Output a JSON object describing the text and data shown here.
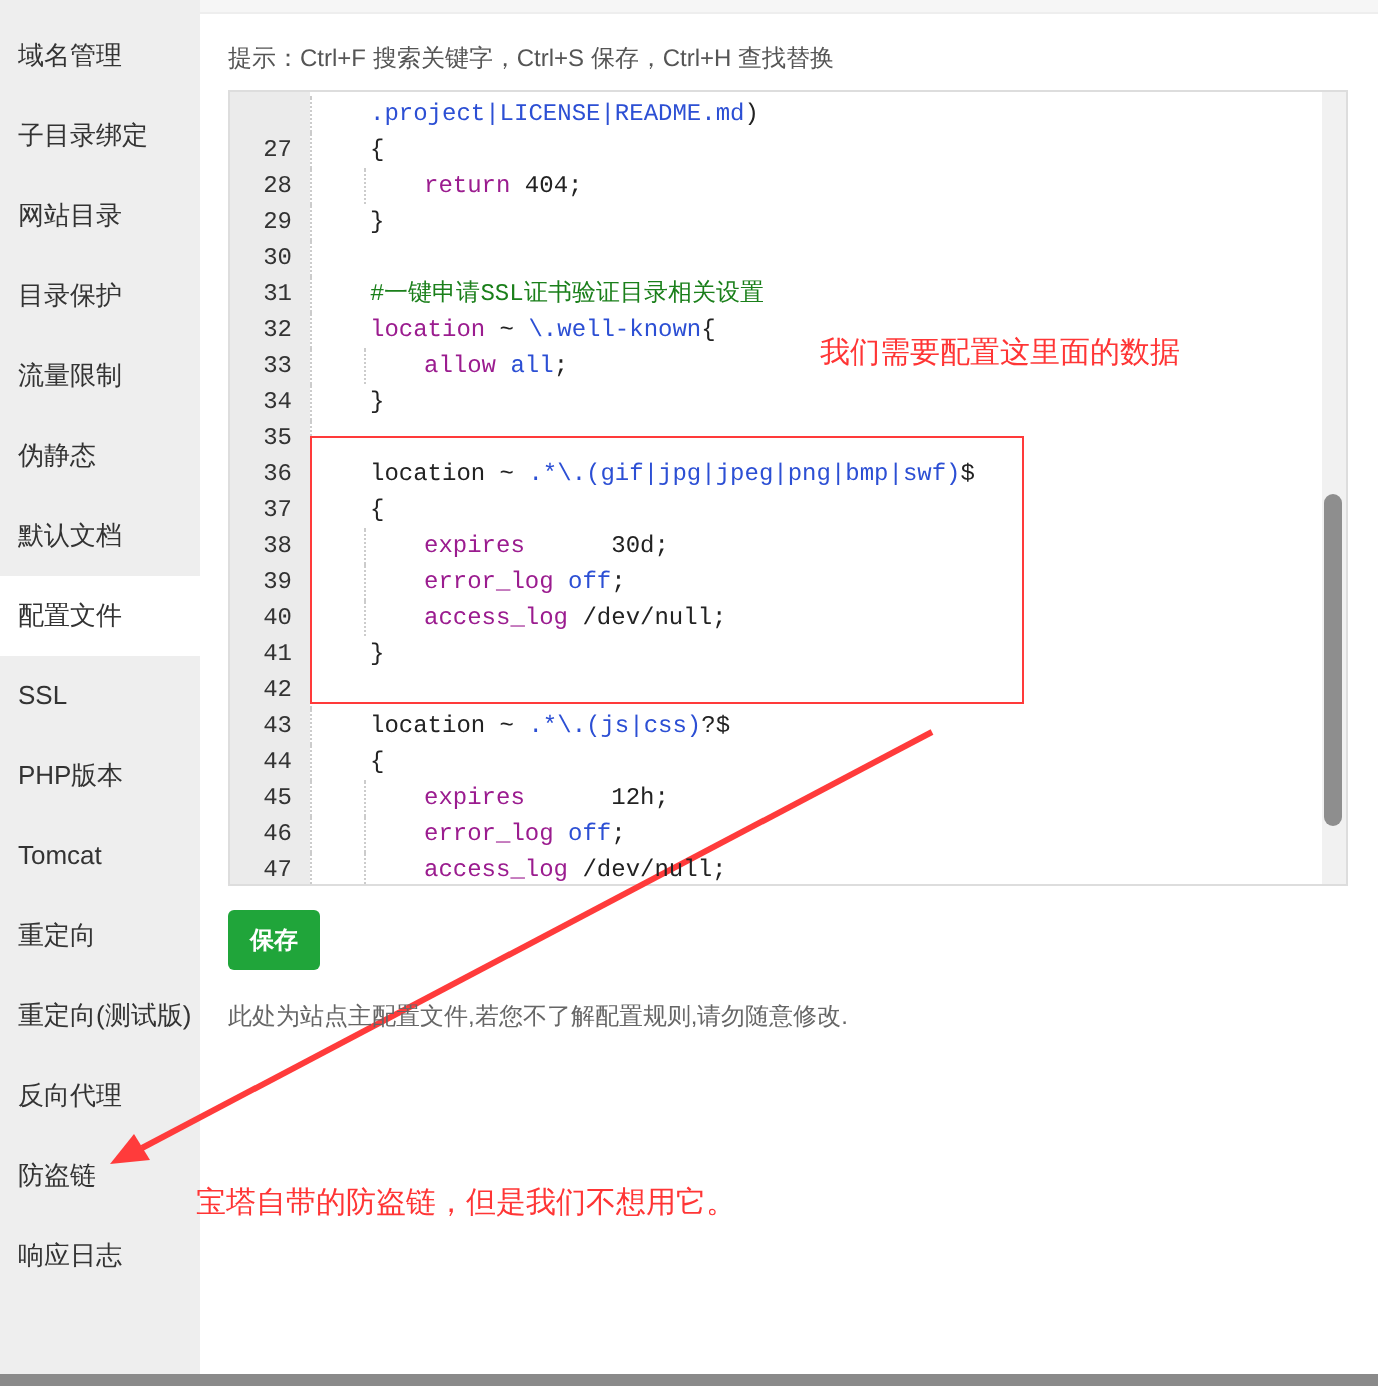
{
  "sidebar": {
    "items": [
      {
        "label": "域名管理",
        "selected": false
      },
      {
        "label": "子目录绑定",
        "selected": false
      },
      {
        "label": "网站目录",
        "selected": false
      },
      {
        "label": "目录保护",
        "selected": false
      },
      {
        "label": "流量限制",
        "selected": false
      },
      {
        "label": "伪静态",
        "selected": false
      },
      {
        "label": "默认文档",
        "selected": false
      },
      {
        "label": "配置文件",
        "selected": true
      },
      {
        "label": "SSL",
        "selected": false
      },
      {
        "label": "PHP版本",
        "selected": false
      },
      {
        "label": "Tomcat",
        "selected": false
      },
      {
        "label": "重定向",
        "selected": false
      },
      {
        "label": "重定向(测试版)",
        "selected": false
      },
      {
        "label": "反向代理",
        "selected": false
      },
      {
        "label": "防盗链",
        "selected": false
      },
      {
        "label": "响应日志",
        "selected": false
      }
    ]
  },
  "hint": "提示：Ctrl+F 搜索关键字，Ctrl+S 保存，Ctrl+H 查找替换",
  "editor": {
    "lines": [
      {
        "tokens": [
          {
            "text": ".project|LICENSE|README.md",
            "kind": "value"
          },
          {
            "text": ")",
            "kind": "plain"
          }
        ]
      },
      {
        "number": "27",
        "tokens": [
          {
            "text": "{",
            "kind": "plain"
          }
        ],
        "children": [
          {
            "number": "28",
            "tokens": [
              {
                "text": "return",
                "kind": "keyword"
              },
              {
                "text": " 404;",
                "kind": "plain"
              }
            ]
          }
        ]
      },
      {
        "number": "29",
        "tokens": [
          {
            "text": "}",
            "kind": "plain"
          }
        ]
      },
      {
        "number": "30"
      },
      {
        "number": "31",
        "tokens": [
          {
            "text": "#一键申请SSL证书验证目录相关设置",
            "kind": "comment"
          }
        ]
      },
      {
        "number": "32",
        "tokens": [
          {
            "text": "location",
            "kind": "keyword"
          },
          {
            "text": " ~ ",
            "kind": "plain"
          },
          {
            "text": "\\.well-known",
            "kind": "value"
          },
          {
            "text": "{",
            "kind": "plain"
          }
        ],
        "children": [
          {
            "number": "33",
            "tokens": [
              {
                "text": "allow ",
                "kind": "keyword"
              },
              {
                "text": "all",
                "kind": "value"
              },
              {
                "text": ";",
                "kind": "plain"
              }
            ]
          }
        ]
      },
      {
        "number": "34",
        "tokens": [
          {
            "text": "}",
            "kind": "plain"
          }
        ]
      },
      {
        "number": "35"
      },
      {
        "number": "36",
        "tokens": [
          {
            "text": "location ~ ",
            "kind": "plain"
          },
          {
            "text": ".*\\.(gif|jpg|jpeg|png|bmp|swf)",
            "kind": "value"
          },
          {
            "text": "$",
            "kind": "plain"
          }
        ]
      },
      {
        "number": "37",
        "tokens": [
          {
            "text": "{",
            "kind": "plain"
          }
        ],
        "children": [
          {
            "number": "38",
            "tokens": [
              {
                "text": "expires",
                "kind": "keyword"
              },
              {
                "text": "      30d;",
                "kind": "plain"
              }
            ]
          },
          {
            "number": "39",
            "tokens": [
              {
                "text": "error_log ",
                "kind": "keyword"
              },
              {
                "text": "off",
                "kind": "value"
              },
              {
                "text": ";",
                "kind": "plain"
              }
            ]
          },
          {
            "number": "40",
            "tokens": [
              {
                "text": "access_log",
                "kind": "keyword"
              },
              {
                "text": " /dev/null;",
                "kind": "plain"
              }
            ]
          }
        ]
      },
      {
        "number": "41",
        "tokens": [
          {
            "text": "}",
            "kind": "plain"
          }
        ]
      },
      {
        "number": "42"
      },
      {
        "number": "43",
        "tokens": [
          {
            "text": "location ~ ",
            "kind": "plain"
          },
          {
            "text": ".*\\.(js|css)",
            "kind": "value"
          },
          {
            "text": "?$",
            "kind": "plain"
          }
        ]
      },
      {
        "number": "44",
        "tokens": [
          {
            "text": "{",
            "kind": "plain"
          }
        ],
        "children": [
          {
            "number": "45",
            "tokens": [
              {
                "text": "expires",
                "kind": "keyword"
              },
              {
                "text": "      12h;",
                "kind": "plain"
              }
            ]
          },
          {
            "number": "46",
            "tokens": [
              {
                "text": "error_log ",
                "kind": "keyword"
              },
              {
                "text": "off",
                "kind": "value"
              },
              {
                "text": ";",
                "kind": "plain"
              }
            ]
          },
          {
            "number": "47",
            "tokens": [
              {
                "text": "access_log",
                "kind": "keyword"
              },
              {
                "text": " /dev/null;",
                "kind": "plain"
              }
            ]
          }
        ]
      }
    ]
  },
  "save_button": "保存",
  "note": "此处为站点主配置文件,若您不了解配置规则,请勿随意修改.",
  "annotations": {
    "top_note": "我们需要配置这里面的数据",
    "bottom_note": "宝塔自带的防盗链，但是我们不想用它。"
  }
}
